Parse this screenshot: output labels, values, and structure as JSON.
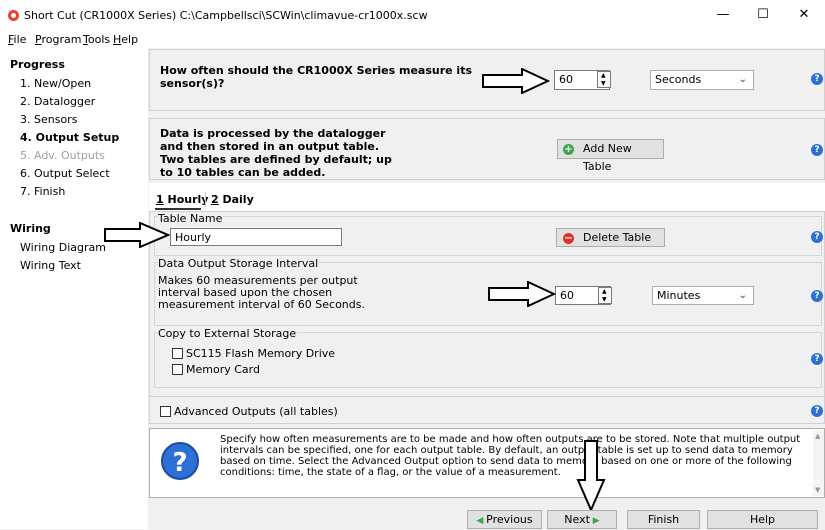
{
  "window": {
    "title": "Short Cut (CR1000X Series) C:\\Campbellsci\\SCWin\\climavue-cr1000x.scw",
    "minimize": "—",
    "maximize": "☐",
    "close": "✕"
  },
  "menu": [
    {
      "key": "F",
      "rest": "ile"
    },
    {
      "key": "P",
      "rest": "rogram"
    },
    {
      "key": "T",
      "rest": "ools"
    },
    {
      "key": "H",
      "rest": "elp"
    }
  ],
  "sidebar": {
    "progress_heading": "Progress",
    "steps": [
      "1. New/Open",
      "2. Datalogger",
      "3. Sensors",
      "4. Output Setup",
      "5. Adv. Outputs",
      "6. Output Select",
      "7. Finish"
    ],
    "wiring_heading": "Wiring",
    "wiring_items": [
      "Wiring Diagram",
      "Wiring Text"
    ]
  },
  "measure": {
    "question": "How often should the CR1000X Series measure its sensor(s)?",
    "value": "60",
    "unit": "Seconds"
  },
  "table_info": {
    "text": "Data is processed by the datalogger and then stored in an output table. Two tables are defined by default; up to 10 tables can be added.",
    "add_button": "Add New Table"
  },
  "tabs": [
    {
      "key": "1",
      "rest": " Hourly"
    },
    {
      "key": "2",
      "rest": " Daily"
    }
  ],
  "table_name": {
    "label": "Table Name",
    "value": "Hourly",
    "delete_button": "Delete Table"
  },
  "interval": {
    "label": "Data Output Storage Interval",
    "text": "Makes 60 measurements per output interval based upon the chosen measurement interval of 60 Seconds.",
    "value": "60",
    "unit": "Minutes"
  },
  "external": {
    "label": "Copy to External Storage",
    "options": [
      "SC115 Flash Memory Drive",
      "Memory Card"
    ]
  },
  "advanced": {
    "label": "Advanced Outputs (all tables)"
  },
  "help_text": "Specify how often measurements are to be made and how often outputs are to be stored. Note that multiple output intervals can be specified, one for each output table. By default, an output table is set up to send data to memory based on time. Select the Advanced Output option to send data to memory based on one or more of the following conditions: time, the state of a flag, or the value of a measurement.",
  "buttons": {
    "previous": "Previous",
    "next": "Next",
    "finish": "Finish",
    "help": "Help"
  },
  "colors": {
    "help_blue": "#2e6fd6",
    "add_green": "#3aa64a",
    "delete_red": "#d9342b"
  }
}
